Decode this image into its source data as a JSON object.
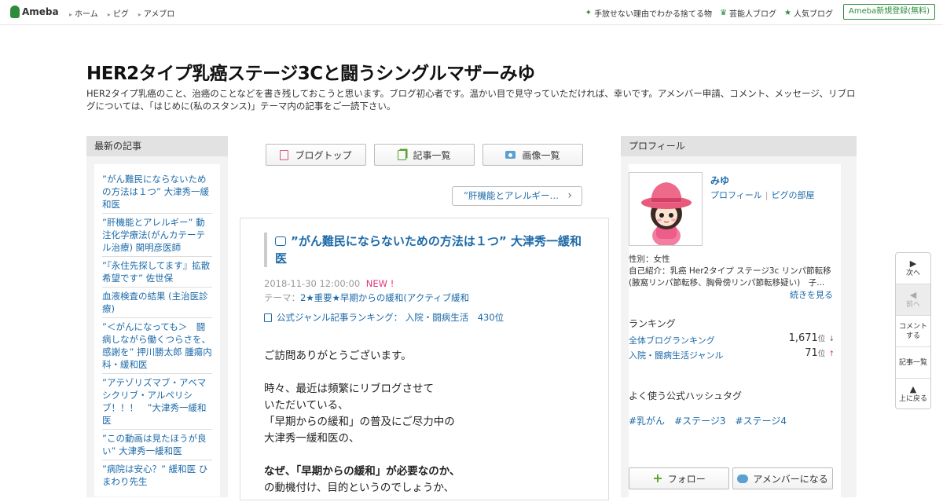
{
  "topbar": {
    "logo": "Ameba",
    "nav": [
      "ホーム",
      "ピグ",
      "アメブロ"
    ],
    "right_links": [
      {
        "icon": "sparkle-icon",
        "label": "手放せない理由でわかる捨てる物"
      },
      {
        "icon": "crown-icon",
        "label": "芸能人ブログ"
      },
      {
        "icon": "star-icon",
        "label": "人気ブログ"
      }
    ],
    "register": "Ameba新規登録(無料)"
  },
  "header": {
    "title": "HER2タイプ乳癌ステージ3Cと闘うシングルマザーみゆ",
    "description": "HER2タイプ乳癌のこと、治癌のことなどを書き残しておこうと思います。ブログ初心者です。温かい目で見守っていただければ、幸いです。アメンバー申請、コメント、メッセージ、リブログについては、「はじめに(私のスタンス)」テーマ内の記事をご一読下さい。"
  },
  "left": {
    "heading": "最新の記事",
    "items": [
      "”がん難民にならないための方法は１つ” 大津秀一緩和医",
      "”肝機能とアレルギー” 動注化学療法(がんカテーテル治療) 関明彦医師",
      "”『永住先探してます』拡散希望です” 佐世保",
      "血液検査の結果 (主治医診療)",
      "”＜がんになっても＞　闘病しながら働くつらさを、感謝を” 押川勝太郎 腫瘍内科・緩和医",
      "”アテゾリズマブ・アベマシクリブ・アルペリシブ！！！　”大津秀一緩和医",
      "”この動画は見たほうが良い” 大津秀一緩和医",
      "”病院は安心？” 緩和医 ひまわり先生"
    ]
  },
  "center": {
    "buttons": [
      {
        "icon": "blog-top-icon",
        "label": "ブログトップ"
      },
      {
        "icon": "article-list-icon",
        "label": "記事一覧"
      },
      {
        "icon": "camera-icon",
        "label": "画像一覧"
      }
    ],
    "prev_article": "”肝機能とアレルギー…",
    "article": {
      "title": "”がん難民にならないための方法は１つ” 大津秀一緩和医",
      "date": "2018-11-30 12:00:00",
      "new": "NEW !",
      "theme_label": "テーマ：",
      "theme": "2★重要★早期からの緩和(アクティブ緩和",
      "ranking": "公式ジャンル記事ランキング：  入院・闘病生活　430位",
      "body": [
        {
          "text": "ご訪問ありがとうございます。",
          "bold": false
        },
        {
          "text": "",
          "bold": false
        },
        {
          "text": "時々、最近は頻繁にリブログさせて",
          "bold": false
        },
        {
          "text": "いただいている、",
          "bold": false
        },
        {
          "text": "「早期からの緩和」の普及にご尽力中の",
          "bold": false
        },
        {
          "text": "大津秀一緩和医の、",
          "bold": false
        },
        {
          "text": "",
          "bold": false
        },
        {
          "text": "なぜ、「早期からの緩和」が必要なのか、",
          "bold": true
        },
        {
          "text": "の動機付け、目的というのでしょうか、",
          "bold": false
        }
      ]
    }
  },
  "right": {
    "heading": "プロフィール",
    "name": "みゆ",
    "links": [
      "プロフィール",
      "ピグの部屋"
    ],
    "sex": "性別：女性",
    "intro": "自己紹介：乳癌 Her2タイプ ステージ3c リンパ節転移 (腋窩リンパ節転移、胸骨傍リンパ節転移疑い)　子...",
    "more": "続きを見る",
    "ranking_title": "ランキング",
    "rankings": [
      {
        "label": "全体ブログランキング",
        "value": "1,671",
        "unit": "位",
        "trend": "↓"
      },
      {
        "label": "入院・闘病生活ジャンル",
        "value": "71",
        "unit": "位",
        "trend": "↑"
      }
    ],
    "hashtag_title": "よく使う公式ハッシュタグ",
    "hashtags": [
      "#乳がん",
      "#ステージ3",
      "#ステージ4"
    ],
    "follow": "フォロー",
    "amember": "アメンバーになる"
  },
  "sidenav": [
    {
      "icon": "▶",
      "label": "次へ",
      "disabled": false
    },
    {
      "icon": "◀",
      "label": "前へ",
      "disabled": true
    },
    {
      "icon": "",
      "label": "コメントする",
      "disabled": false
    },
    {
      "icon": "",
      "label": "記事一覧",
      "disabled": false
    },
    {
      "icon": "▲",
      "label": "上に戻る",
      "disabled": false
    }
  ],
  "colors": {
    "brand": "#2d8c3c",
    "link": "#1d6aa8",
    "new": "#e3357d"
  }
}
